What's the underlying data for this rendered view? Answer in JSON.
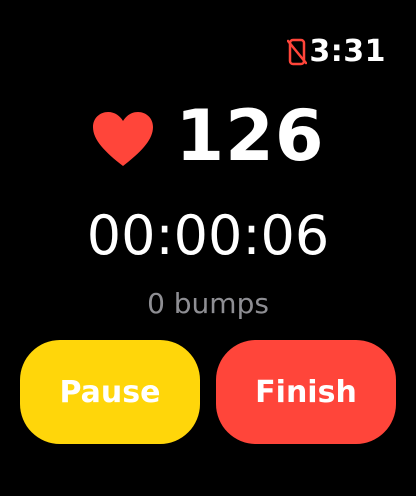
{
  "colors": {
    "background": "#000000",
    "heart": "#ff453a",
    "pause_button": "#ffd60a",
    "finish_button": "#ff453a",
    "secondary_text": "#8e8e93",
    "no_phone_icon": "#ff453a"
  },
  "status_bar": {
    "icon": "no-phone-connection-icon",
    "time": "3:31"
  },
  "workout": {
    "heart_icon": "heart-icon",
    "heart_rate": "126",
    "elapsed_time": "00:00:06",
    "bumps_text": "0 bumps"
  },
  "controls": {
    "pause_label": "Pause",
    "finish_label": "Finish"
  }
}
